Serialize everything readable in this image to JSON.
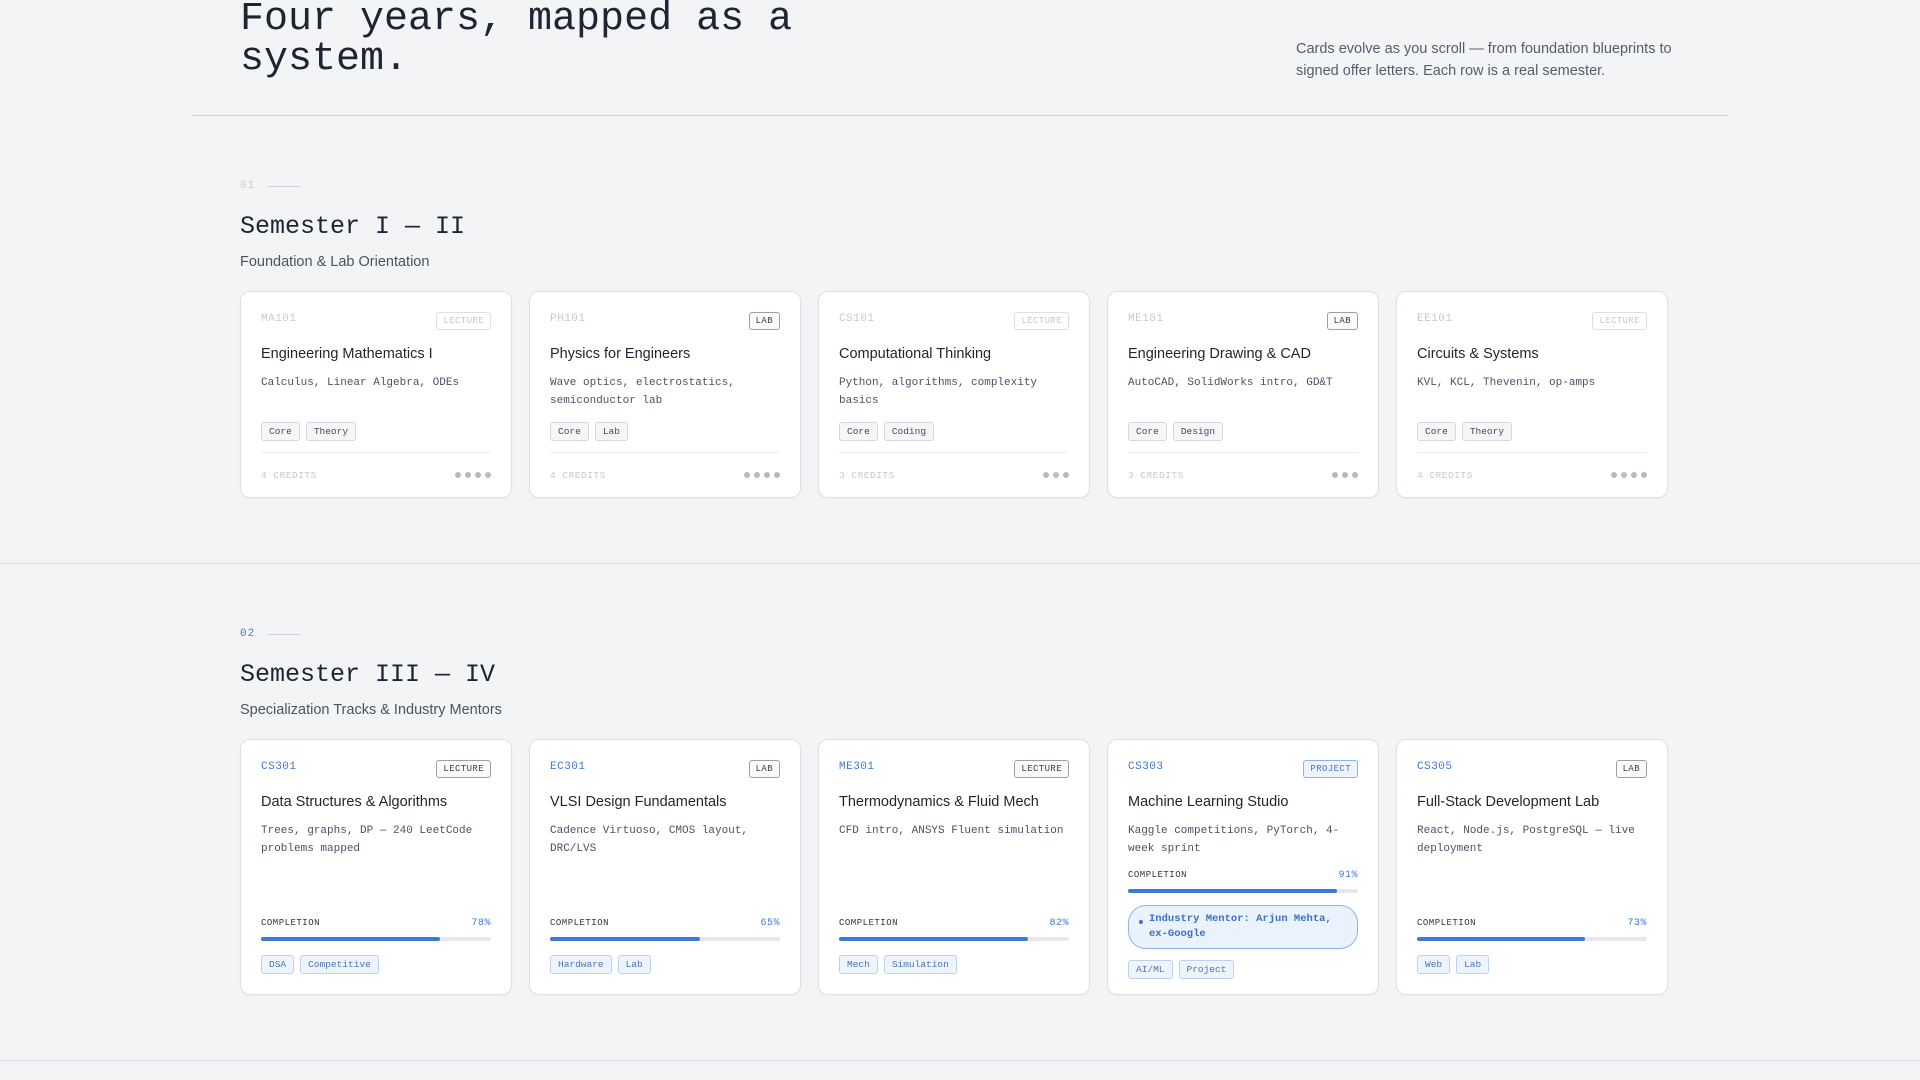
{
  "hero": {
    "title": "Four years, mapped as a system.",
    "description": "Cards evolve as you scroll — from foundation blueprints to signed offer letters. Each row is a real semester."
  },
  "sections": [
    {
      "number": "01",
      "title": "Semester I — II",
      "subtitle": "Foundation & Lab Orientation",
      "cards": [
        {
          "code": "MA101",
          "type": "LECTURE",
          "title": "Engineering Mathematics I",
          "desc": "Calculus, Linear Algebra, ODEs",
          "tags": [
            "Core",
            "Theory"
          ],
          "credits": "4 CREDITS",
          "dots": 4
        },
        {
          "code": "PH101",
          "type": "LAB",
          "title": "Physics for Engineers",
          "desc": "Wave optics, electrostatics, semiconductor lab",
          "tags": [
            "Core",
            "Lab"
          ],
          "credits": "4 CREDITS",
          "dots": 4
        },
        {
          "code": "CS101",
          "type": "LECTURE",
          "title": "Computational Thinking",
          "desc": "Python, algorithms, complexity basics",
          "tags": [
            "Core",
            "Coding"
          ],
          "credits": "3 CREDITS",
          "dots": 3
        },
        {
          "code": "ME101",
          "type": "LAB",
          "title": "Engineering Drawing & CAD",
          "desc": "AutoCAD, SolidWorks intro, GD&T",
          "tags": [
            "Core",
            "Design"
          ],
          "credits": "3 CREDITS",
          "dots": 3
        },
        {
          "code": "EE101",
          "type": "LECTURE",
          "title": "Circuits & Systems",
          "desc": "KVL, KCL, Thevenin, op-amps",
          "tags": [
            "Core",
            "Theory"
          ],
          "credits": "4 CREDITS",
          "dots": 4
        }
      ]
    },
    {
      "number": "02",
      "title": "Semester III — IV",
      "subtitle": "Specialization Tracks & Industry Mentors",
      "completion_label": "COMPLETION",
      "cards": [
        {
          "code": "CS301",
          "type": "LECTURE",
          "title": "Data Structures & Algorithms",
          "desc": "Trees, graphs, DP — 240 LeetCode problems mapped",
          "completion": "78%",
          "completion_value": 0.78,
          "tags": [
            "DSA",
            "Competitive"
          ]
        },
        {
          "code": "EC301",
          "type": "LAB",
          "title": "VLSI Design Fundamentals",
          "desc": "Cadence Virtuoso, CMOS layout, DRC/LVS",
          "completion": "65%",
          "completion_value": 0.65,
          "tags": [
            "Hardware",
            "Lab"
          ]
        },
        {
          "code": "ME301",
          "type": "LECTURE",
          "title": "Thermodynamics & Fluid Mech",
          "desc": "CFD intro, ANSYS Fluent simulation",
          "completion": "82%",
          "completion_value": 0.82,
          "tags": [
            "Mech",
            "Simulation"
          ]
        },
        {
          "code": "CS303",
          "type": "PROJECT",
          "title": "Machine Learning Studio",
          "desc": "Kaggle competitions, PyTorch, 4-week sprint",
          "completion": "91%",
          "completion_value": 0.91,
          "mentor": "Industry Mentor: Arjun Mehta, ex-Google",
          "tags": [
            "AI/ML",
            "Project"
          ]
        },
        {
          "code": "CS305",
          "type": "LAB",
          "title": "Full-Stack Development Lab",
          "desc": "React, Node.js, PostgreSQL — live deployment",
          "completion": "73%",
          "completion_value": 0.73,
          "tags": [
            "Web",
            "Lab"
          ]
        }
      ]
    }
  ],
  "colors": {
    "accent": "#3d7ad6",
    "background": "#f3f4f6"
  }
}
